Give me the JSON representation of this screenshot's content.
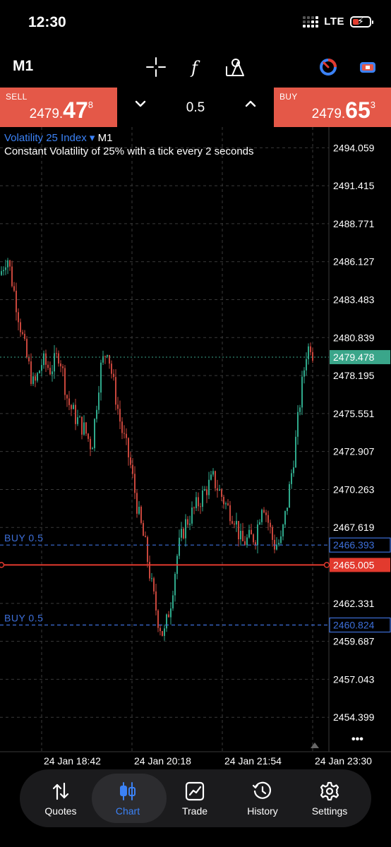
{
  "status": {
    "time": "12:30",
    "network": "LTE"
  },
  "toolbar": {
    "timeframe": "M1"
  },
  "trade": {
    "sell": {
      "label": "SELL",
      "price_main": "2479.",
      "price_big": "47",
      "price_small": "8"
    },
    "buy": {
      "label": "BUY",
      "price_main": "2479.",
      "price_big": "65",
      "price_small": "3"
    },
    "volume": "0.5"
  },
  "chart": {
    "symbol": "Volatility 25 Index",
    "symbol_arrow": "▾",
    "timeframe": "M1",
    "description": "Constant Volatility of 25% with a tick every 2 seconds",
    "price_labels": [
      "2494.059",
      "2491.415",
      "2488.771",
      "2486.127",
      "2483.483",
      "2480.839",
      "2478.195",
      "2475.551",
      "2472.907",
      "2470.263",
      "2467.619",
      "2462.331",
      "2459.687",
      "2457.043",
      "2454.399"
    ],
    "current_price": "2479.478",
    "orders": [
      {
        "label": "BUY 0.5",
        "price": "2466.393"
      },
      {
        "label": "BUY 0.5",
        "price": "2460.824"
      }
    ],
    "stop_price": "2465.005",
    "time_labels": [
      "24 Jan 18:42",
      "24 Jan 20:18",
      "24 Jan 21:54",
      "24 Jan 23:30"
    ],
    "more": "•••",
    "colors": {
      "up": "#2fa98b",
      "down": "#c8463c",
      "order": "#3d6fd9",
      "stop": "#e23a2e",
      "current": "#3aa68a"
    }
  },
  "nav": {
    "items": [
      {
        "label": "Quotes",
        "icon": "quotes-icon"
      },
      {
        "label": "Chart",
        "icon": "chart-icon"
      },
      {
        "label": "Trade",
        "icon": "trade-icon"
      },
      {
        "label": "History",
        "icon": "history-icon"
      },
      {
        "label": "Settings",
        "icon": "settings-icon"
      }
    ],
    "active": "Chart"
  }
}
